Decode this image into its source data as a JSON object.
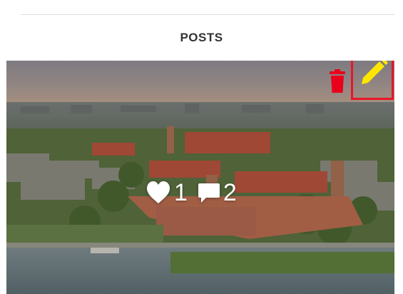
{
  "section": {
    "title": "POSTS"
  },
  "post": {
    "likes_count": "1",
    "comments_count": "2",
    "icons": {
      "delete": "trash-icon",
      "edit": "pencil-icon",
      "like": "heart-icon",
      "comment": "comment-icon"
    },
    "colors": {
      "delete_icon": "#e8001c",
      "edit_icon": "#ffe600",
      "edit_highlight_border": "#e8162a",
      "stat_text": "#ffffff"
    }
  }
}
